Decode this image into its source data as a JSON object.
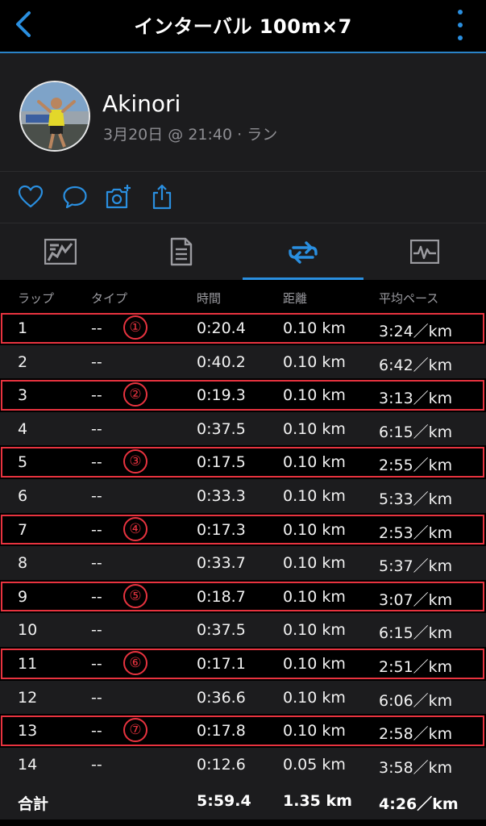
{
  "header": {
    "title": "インターバル 100m×7",
    "back_icon": "chevron-left-icon",
    "more_icon": "more-vertical-icon",
    "accent": "#2a8fe0"
  },
  "profile": {
    "name": "Akinori",
    "meta": "3月20日 @ 21:40 · ラン"
  },
  "actions": [
    "heart-icon",
    "comment-icon",
    "add-photo-icon",
    "share-icon"
  ],
  "tabs": [
    {
      "icon": "map-summary-icon",
      "active": false
    },
    {
      "icon": "details-list-icon",
      "active": false
    },
    {
      "icon": "laps-icon",
      "active": true
    },
    {
      "icon": "chart-icon",
      "active": false
    }
  ],
  "table": {
    "headers": {
      "lap": "ラップ",
      "type": "タイプ",
      "time": "時間",
      "distance": "距離",
      "pace": "平均ペース"
    },
    "rows": [
      {
        "lap": "1",
        "type": "--",
        "time": "0:20.4",
        "distance": "0.10 km",
        "pace": "3:24／km",
        "marker": "①"
      },
      {
        "lap": "2",
        "type": "--",
        "time": "0:40.2",
        "distance": "0.10 km",
        "pace": "6:42／km",
        "marker": ""
      },
      {
        "lap": "3",
        "type": "--",
        "time": "0:19.3",
        "distance": "0.10 km",
        "pace": "3:13／km",
        "marker": "②"
      },
      {
        "lap": "4",
        "type": "--",
        "time": "0:37.5",
        "distance": "0.10 km",
        "pace": "6:15／km",
        "marker": ""
      },
      {
        "lap": "5",
        "type": "--",
        "time": "0:17.5",
        "distance": "0.10 km",
        "pace": "2:55／km",
        "marker": "③"
      },
      {
        "lap": "6",
        "type": "--",
        "time": "0:33.3",
        "distance": "0.10 km",
        "pace": "5:33／km",
        "marker": ""
      },
      {
        "lap": "7",
        "type": "--",
        "time": "0:17.3",
        "distance": "0.10 km",
        "pace": "2:53／km",
        "marker": "④"
      },
      {
        "lap": "8",
        "type": "--",
        "time": "0:33.7",
        "distance": "0.10 km",
        "pace": "5:37／km",
        "marker": ""
      },
      {
        "lap": "9",
        "type": "--",
        "time": "0:18.7",
        "distance": "0.10 km",
        "pace": "3:07／km",
        "marker": "⑤"
      },
      {
        "lap": "10",
        "type": "--",
        "time": "0:37.5",
        "distance": "0.10 km",
        "pace": "6:15／km",
        "marker": ""
      },
      {
        "lap": "11",
        "type": "--",
        "time": "0:17.1",
        "distance": "0.10 km",
        "pace": "2:51／km",
        "marker": "⑥"
      },
      {
        "lap": "12",
        "type": "--",
        "time": "0:36.6",
        "distance": "0.10 km",
        "pace": "6:06／km",
        "marker": ""
      },
      {
        "lap": "13",
        "type": "--",
        "time": "0:17.8",
        "distance": "0.10 km",
        "pace": "2:58／km",
        "marker": "⑦"
      },
      {
        "lap": "14",
        "type": "--",
        "time": "0:12.6",
        "distance": "0.05 km",
        "pace": "3:58／km",
        "marker": ""
      }
    ],
    "total": {
      "label": "合計",
      "time": "5:59.4",
      "distance": "1.35 km",
      "pace": "4:26／km"
    },
    "highlight_color": "#e8333f"
  }
}
